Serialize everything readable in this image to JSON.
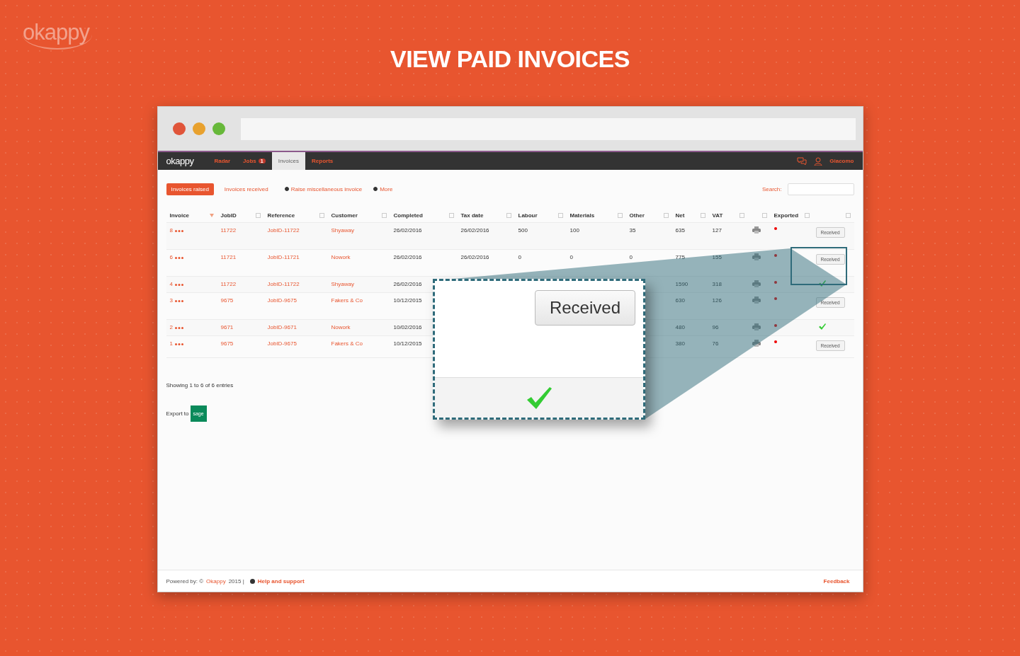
{
  "brand_logo": "okappy",
  "headline": "VIEW PAID INVOICES",
  "app": {
    "logo": "okappy",
    "nav": [
      {
        "label": "Radar",
        "selected": false
      },
      {
        "label": "Jobs",
        "badge": "1",
        "selected": false
      },
      {
        "label": "Invoices",
        "selected": true
      },
      {
        "label": "Reports",
        "selected": false
      }
    ],
    "user": "Giacomo",
    "subtabs": [
      {
        "label": "Invoices raised",
        "selected": true
      },
      {
        "label": "Invoices received",
        "selected": false
      }
    ],
    "actions": [
      "Raise miscellaneous invoice",
      "More"
    ],
    "search": {
      "label": "Search:"
    },
    "table": {
      "columns": [
        {
          "kind": "text",
          "label": "Invoice"
        },
        {
          "kind": "text",
          "label": "JobID"
        },
        {
          "kind": "text",
          "label": "Reference"
        },
        {
          "kind": "text",
          "label": "Customer"
        },
        {
          "kind": "text",
          "label": "Completed"
        },
        {
          "kind": "text",
          "label": "Tax date"
        },
        {
          "kind": "text",
          "label": "Labour"
        },
        {
          "kind": "text",
          "label": "Materials"
        },
        {
          "kind": "text",
          "label": "Other"
        },
        {
          "kind": "text",
          "label": "Net"
        },
        {
          "kind": "text",
          "label": "VAT"
        },
        {
          "kind": "blank"
        },
        {
          "kind": "text",
          "label": "Exported"
        },
        {
          "kind": "blank"
        }
      ],
      "rows": [
        {
          "cells": [
            "8",
            "11722",
            "JobID-11722",
            "Shyaway",
            "26/02/2016",
            "26/02/2016",
            "500",
            "100",
            "35",
            "635",
            "127"
          ],
          "exported": false,
          "action": {
            "kind": "button",
            "label": "Received"
          }
        },
        {
          "cells": [
            "6",
            "11721",
            "JobID-11721",
            "Nowork",
            "26/02/2016",
            "26/02/2016",
            "0",
            "0",
            "0",
            "775",
            "155"
          ],
          "exported": false,
          "action": {
            "kind": "button",
            "label": "Received"
          }
        },
        {
          "cells": [
            "4",
            "11722",
            "JobID-11722",
            "Shyaway",
            "26/02/2016",
            null,
            null,
            null,
            null,
            "1590",
            "318"
          ],
          "exported": false,
          "action": {
            "kind": "tick"
          }
        },
        {
          "cells": [
            "3",
            "9675",
            "JobID-9675",
            "Fakers & Co",
            "10/12/2015",
            null,
            null,
            null,
            null,
            "630",
            "126"
          ],
          "exported": false,
          "action": {
            "kind": "button",
            "label": "Received"
          }
        },
        {
          "cells": [
            "2",
            "9671",
            "JobID-9671",
            "Nowork",
            "10/02/2016",
            null,
            null,
            null,
            null,
            "480",
            "96"
          ],
          "exported": false,
          "action": {
            "kind": "tick"
          }
        },
        {
          "cells": [
            "1",
            "9675",
            "JobID-9675",
            "Fakers & Co",
            "10/12/2015",
            null,
            null,
            null,
            null,
            "380",
            "76"
          ],
          "exported": false,
          "action": {
            "kind": "button",
            "label": "Received"
          }
        }
      ]
    },
    "summary": "Showing 1 to 6 of 6 entries",
    "export": {
      "label": "Export to",
      "logo": "sage"
    },
    "footer": {
      "prefix": "Powered by: ©",
      "link": "Okappy",
      "suffix": "2015 |",
      "help": "Help and support",
      "feedback": "Feedback"
    }
  },
  "callout": {
    "button": "Received"
  }
}
